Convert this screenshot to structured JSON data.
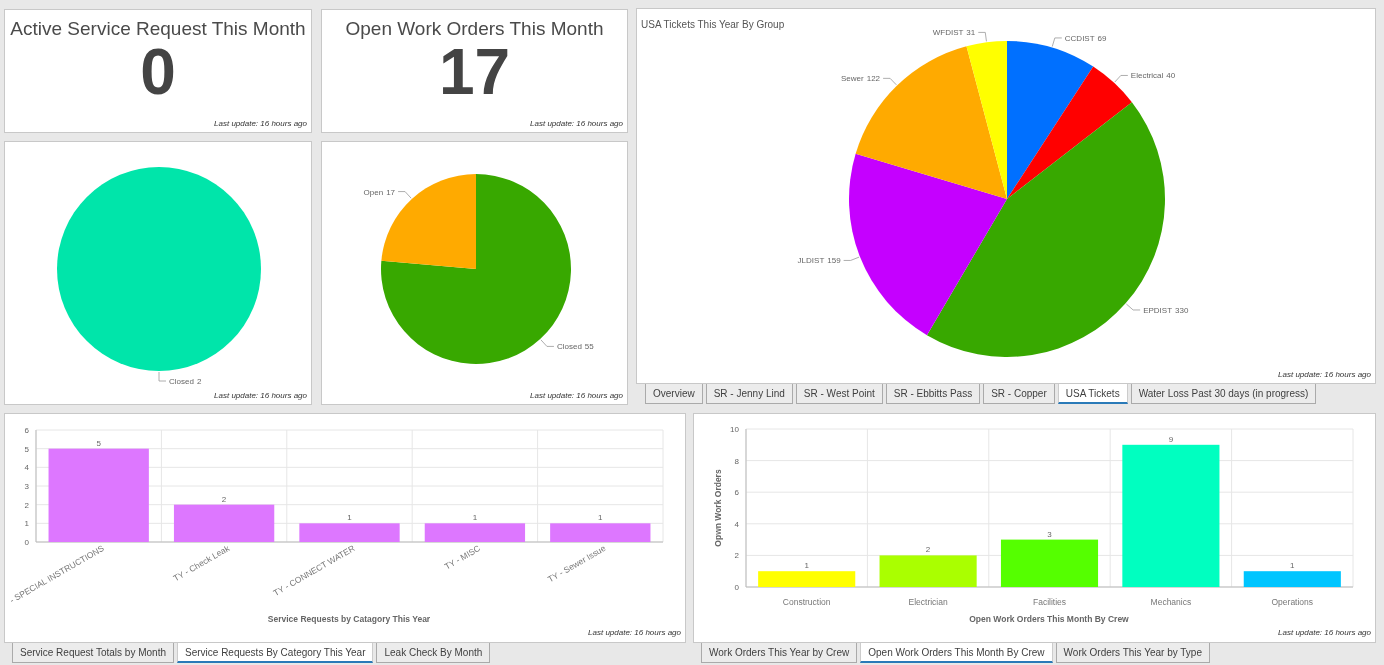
{
  "cards": [
    {
      "title": "Active Service Request This Month",
      "value": "0",
      "updated": "Last update: 16 hours ago"
    },
    {
      "title": "Open Work Orders This Month",
      "value": "17",
      "updated": "Last update: 16 hours ago"
    }
  ],
  "pies": [
    {
      "chart_data": {
        "type": "pie",
        "categories": [
          "Closed"
        ],
        "values": [
          2
        ],
        "colors": [
          "#00e5aa"
        ],
        "value_labels": [
          "2"
        ]
      },
      "updated": "Last update: 16 hours ago"
    },
    {
      "chart_data": {
        "type": "pie",
        "categories": [
          "Closed",
          "Open"
        ],
        "values": [
          55,
          17
        ],
        "colors": [
          "#38a800",
          "#ffaa00"
        ],
        "value_labels": [
          "55",
          "17"
        ]
      },
      "updated": "Last update: 16 hours ago"
    }
  ],
  "usa_panel": {
    "chart_data": {
      "type": "pie",
      "title": "USA Tickets This Year By Group",
      "categories": [
        "CCDIST",
        "Electrical",
        "EPDIST",
        "JLDIST",
        "Sewer",
        "WFDIST"
      ],
      "values": [
        69,
        40,
        330,
        159,
        122,
        31
      ],
      "colors": [
        "#0070ff",
        "#ff0000",
        "#38a800",
        "#c500ff",
        "#ffaa00",
        "#ffff00"
      ],
      "value_labels": [
        "69",
        "40",
        "330",
        "159",
        "122",
        "31"
      ]
    },
    "updated": "Last update: 16 hours ago",
    "tabs": [
      {
        "label": "Overview",
        "selected": false
      },
      {
        "label": "SR - Jenny Lind",
        "selected": false
      },
      {
        "label": "SR - West Point",
        "selected": false
      },
      {
        "label": "SR - Ebbitts Pass",
        "selected": false
      },
      {
        "label": "SR - Copper",
        "selected": false
      },
      {
        "label": "USA Tickets",
        "selected": true
      },
      {
        "label": "Water Loss Past 30 days (in progress)",
        "selected": false
      }
    ]
  },
  "category_panel": {
    "chart_data": {
      "type": "bar",
      "xlabel": "Service Requests by Catagory This Year",
      "categories": [
        "- SPECIAL INSTRUCTIONS",
        "TY - Check Leak",
        "TY - CONNECT WATER",
        "TY - MISC",
        "TY - Sewer Issue"
      ],
      "series": [
        {
          "color": "#dd77ff",
          "values": [
            5,
            2,
            1,
            1,
            1
          ]
        }
      ],
      "ylim": [
        0,
        6
      ],
      "yticks": [
        0,
        1,
        2,
        3,
        4,
        5,
        6
      ],
      "grid": true,
      "data_labels": true
    },
    "updated": "Last update: 16 hours ago",
    "tabs": [
      {
        "label": "Service Request Totals by Month",
        "selected": false
      },
      {
        "label": "Service Requests By Category This Year",
        "selected": true
      },
      {
        "label": "Leak Check By Month",
        "selected": false
      }
    ]
  },
  "crew_panel": {
    "chart_data": {
      "type": "bar",
      "xlabel": "Open Work Orders This Month By Crew",
      "ylabel": "Opwn Work Orders",
      "categories": [
        "Construction",
        "Electrician",
        "Facilities",
        "Mechanics",
        "Operations"
      ],
      "series": [
        {
          "values": [
            1,
            2,
            3,
            9,
            1
          ]
        }
      ],
      "colors": [
        "#ffff00",
        "#aaff00",
        "#55ff00",
        "#00ffc0",
        "#00c5ff"
      ],
      "ylim": [
        0,
        10
      ],
      "yticks": [
        0,
        2,
        4,
        6,
        8,
        10
      ],
      "grid": true,
      "data_labels": true
    },
    "updated": "Last update: 16 hours ago",
    "tabs": [
      {
        "label": "Work Orders This Year by Crew",
        "selected": false
      },
      {
        "label": "Open Work Orders This Month By Crew",
        "selected": true
      },
      {
        "label": "Work Orders This Year by Type",
        "selected": false
      }
    ]
  }
}
